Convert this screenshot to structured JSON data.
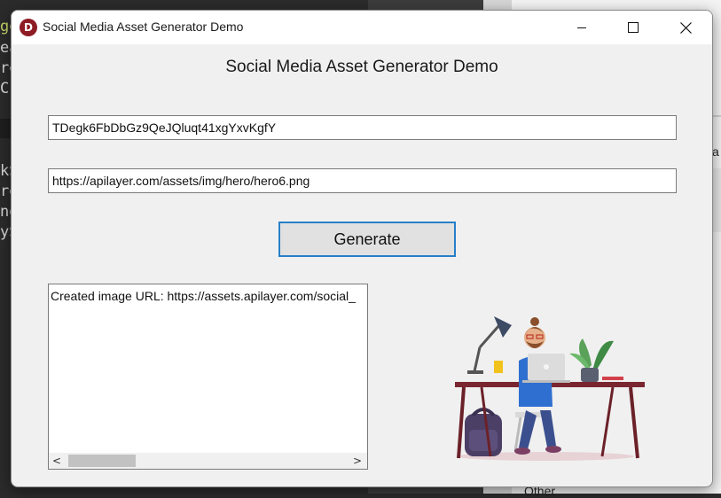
{
  "background": {
    "code_lines": [
      "ge",
      "ea",
      "re",
      "Cr",
      "kS",
      "re",
      "ng",
      "yS"
    ],
    "right_panel_fragments": [
      "a",
      "Other"
    ]
  },
  "window": {
    "title": "Social Media Asset Generator Demo",
    "icon_letter": "D",
    "controls": {
      "minimize": "minimize",
      "maximize": "maximize",
      "close": "close"
    }
  },
  "main": {
    "heading": "Social Media Asset Generator Demo",
    "api_key_value": "TDegk6FbDbGz9QeJQluqt41xgYxvKgfY",
    "image_url_value": "https://apilayer.com/assets/img/hero/hero6.png",
    "generate_label": "Generate",
    "output_text": "Created image URL: https://assets.apilayer.com/social_",
    "scroll_left": "<",
    "scroll_right": ">"
  },
  "colors": {
    "accent_border": "#2680c9",
    "app_icon": "#8e1c24",
    "window_bg": "#f0f0f0"
  }
}
